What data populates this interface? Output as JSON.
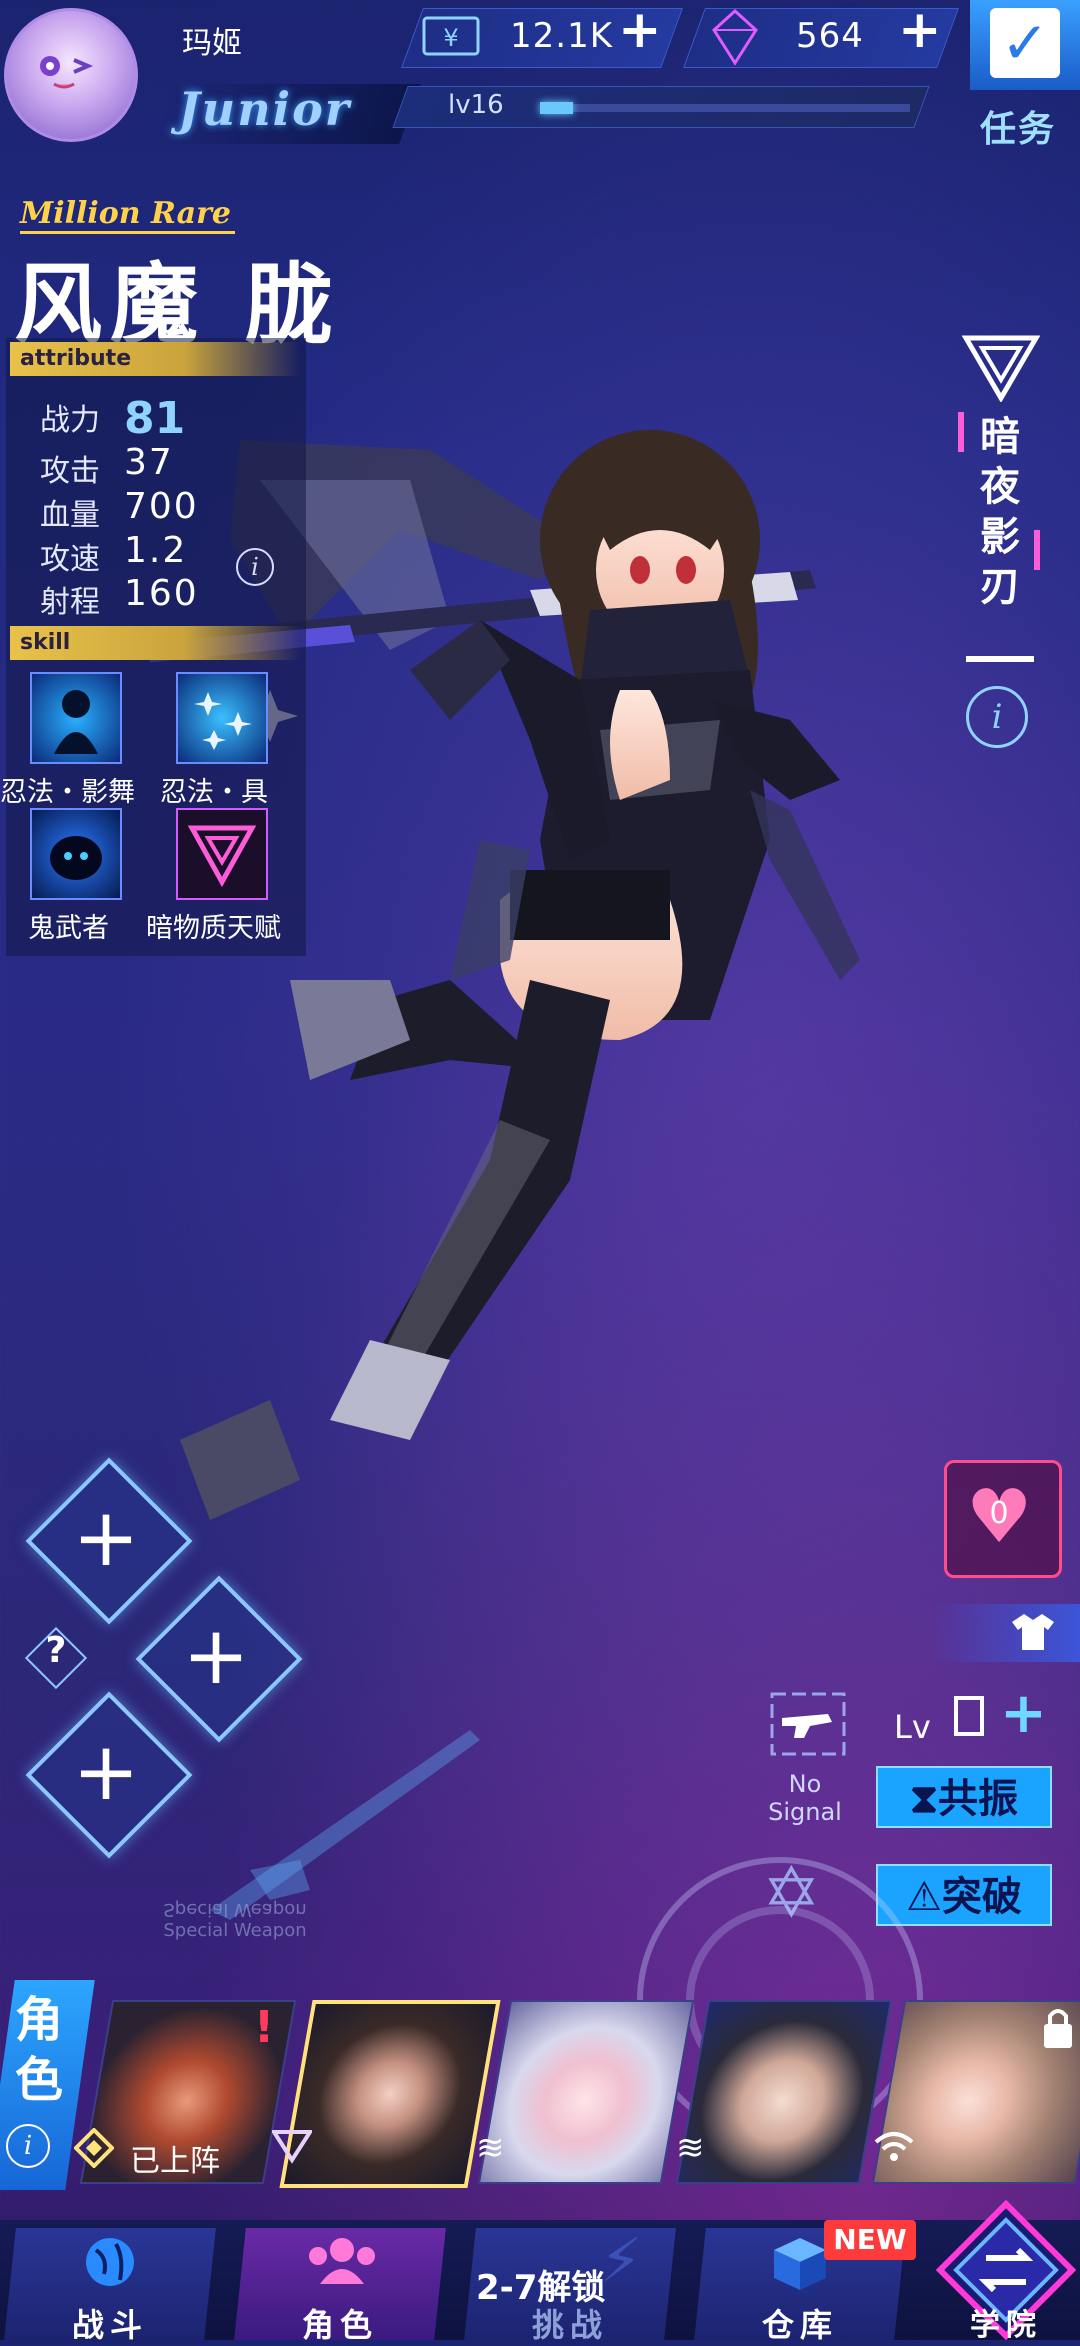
{
  "player": {
    "name": "玛姬",
    "rank": "Junior",
    "level_label": "lv16",
    "level_progress": 0.09
  },
  "currency": {
    "cash": "12.1K",
    "gems": "564"
  },
  "mission": {
    "label": "任务"
  },
  "character": {
    "rarity": "Million Rare",
    "name": "风魔 胧",
    "title_vertical": [
      "暗",
      "夜",
      "影",
      "刃"
    ],
    "attribute_header": "attribute",
    "skill_header": "skill",
    "stats": [
      {
        "label": "战力",
        "value": "81"
      },
      {
        "label": "攻击",
        "value": "37"
      },
      {
        "label": "血量",
        "value": "700"
      },
      {
        "label": "攻速",
        "value": "1.2"
      },
      {
        "label": "射程",
        "value": "160"
      }
    ],
    "skills": [
      {
        "label": "忍法・影舞",
        "icon": "ninja-silhouette-icon"
      },
      {
        "label": "忍法・具",
        "icon": "shuriken-icon"
      },
      {
        "label": "鬼武者",
        "icon": "oni-warrior-icon"
      },
      {
        "label": "暗物质天赋",
        "icon": "triangle-emblem-icon"
      }
    ]
  },
  "equipment": {
    "help": "?",
    "affection": "0",
    "weapon_status": "No Signal",
    "weapon_level_label": "Lv",
    "weapon_level": "0",
    "resonate_label": "共振",
    "breakthrough_label": "突破",
    "special_weapon_text": [
      "Special Weapon",
      "Special Weapon"
    ]
  },
  "roster": {
    "tab_label": "角色",
    "deployed_label": "已上阵",
    "alert": "!"
  },
  "nav": {
    "items": [
      {
        "label": "战斗",
        "icon": "globe-icon"
      },
      {
        "label": "角色",
        "icon": "team-icon"
      },
      {
        "label": "挑战",
        "icon": "lightning-icon",
        "sub": "2-7解锁"
      },
      {
        "label": "仓库",
        "icon": "cube-icon",
        "badge": "NEW"
      },
      {
        "label": "学院",
        "icon": "refresh-diamond-icon"
      }
    ]
  },
  "colors": {
    "accent_blue": "#1aa4ff",
    "gold": "#ffd24a",
    "pink": "#ff4c8c",
    "bg_top": "#1b2470",
    "bg_bottom": "#2a1a5e"
  }
}
